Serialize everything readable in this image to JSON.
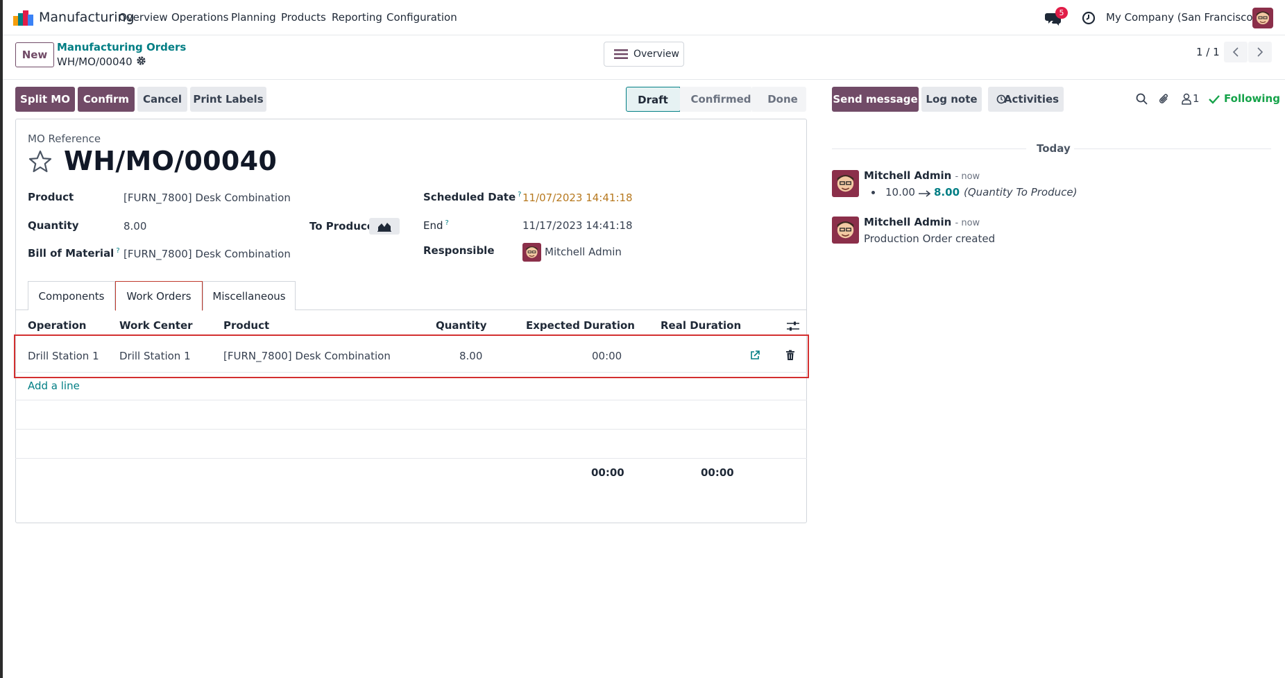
{
  "navbar": {
    "app_name": "Manufacturing",
    "menu": [
      "Overview",
      "Operations",
      "Planning",
      "Products",
      "Reporting",
      "Configuration"
    ],
    "chat_badge": "5",
    "company": "My Company (San Francisco)"
  },
  "control_panel": {
    "new_label": "New",
    "breadcrumb_parent": "Manufacturing Orders",
    "breadcrumb_current": "WH/MO/00040",
    "overview_label": "Overview",
    "pager": "1 / 1"
  },
  "actions": {
    "split_mo": "Split MO",
    "confirm": "Confirm",
    "cancel": "Cancel",
    "print_labels": "Print Labels"
  },
  "status_bar": {
    "states": [
      "Draft",
      "Confirmed",
      "Done"
    ],
    "current": "Draft"
  },
  "form": {
    "mo_reference_label": "MO Reference",
    "mo_reference": "WH/MO/00040",
    "product_label": "Product",
    "product": "[FURN_7800] Desk Combination",
    "quantity_label": "Quantity",
    "quantity": "8.00",
    "to_produce_label": "To Produce",
    "bom_label": "Bill of Material",
    "bom": "[FURN_7800] Desk Combination",
    "scheduled_date_label": "Scheduled Date",
    "scheduled_date": "11/07/2023 14:41:18",
    "end_label": "End",
    "end": "11/17/2023 14:41:18",
    "responsible_label": "Responsible",
    "responsible": "Mitchell Admin",
    "help_mark": "?"
  },
  "tabs": {
    "items": [
      "Components",
      "Work Orders",
      "Miscellaneous"
    ],
    "active": "Work Orders"
  },
  "work_orders": {
    "columns": [
      "Operation",
      "Work Center",
      "Product",
      "Quantity",
      "Expected Duration",
      "Real Duration"
    ],
    "rows": [
      {
        "operation": "Drill Station 1",
        "work_center": "Drill Station 1",
        "product": "[FURN_7800] Desk Combination",
        "quantity": "8.00",
        "expected_duration": "00:00",
        "real_duration": ""
      }
    ],
    "add_line": "Add a line",
    "total_expected": "00:00",
    "total_real": "00:00"
  },
  "chatter": {
    "send_message": "Send message",
    "log_note": "Log note",
    "activities": "Activities",
    "followers_count": "1",
    "following": "Following",
    "date_separator": "Today",
    "messages": [
      {
        "author": "Mitchell Admin",
        "time": "- now",
        "tracking_old": "10.00",
        "tracking_new": "8.00",
        "tracking_field": "(Quantity To Produce)"
      },
      {
        "author": "Mitchell Admin",
        "time": "- now",
        "body": "Production Order created"
      }
    ]
  },
  "colors": {
    "brand": "#714b67",
    "link": "#017e84",
    "warning_date": "#b7791f",
    "following": "#16a34a",
    "highlight_border": "#d32f2f"
  }
}
